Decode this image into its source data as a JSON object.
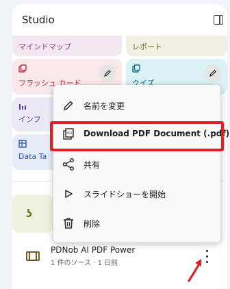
{
  "panel": {
    "title": "Studio"
  },
  "tiles": {
    "mindmap": "マインドマップ",
    "report": "レポート",
    "flashcards": "フラッシュ カード",
    "quiz": "クイズ",
    "infographic": "インフ",
    "datatable": "Data Ta"
  },
  "note": {
    "title": "PDNob AI PDF Power",
    "meta": "1 件のソース · 1 日前"
  },
  "menu": {
    "rename": "名前を変更",
    "download": "Download PDF Document (.pdf)",
    "share": "共有",
    "slideshow": "スライドショーを開始",
    "delete": "削除"
  },
  "colors": {
    "highlight": "#e31e25",
    "arrow": "#e31e25"
  }
}
